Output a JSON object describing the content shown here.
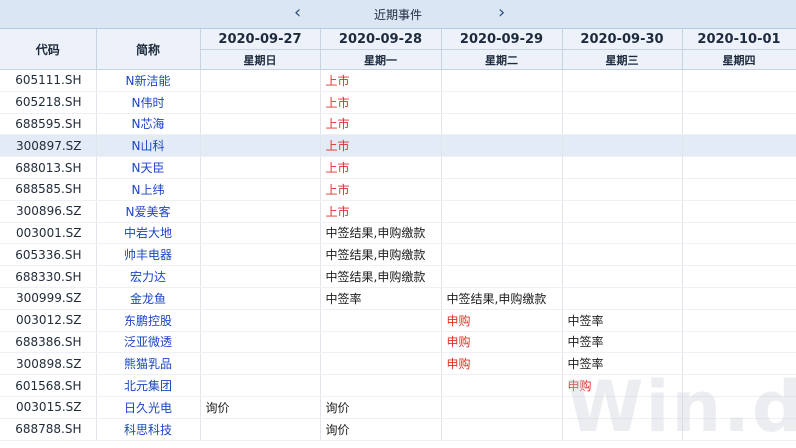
{
  "header": {
    "title": "近期事件",
    "prev_arrow": "‹",
    "next_arrow": "›"
  },
  "columns": {
    "code": "代码",
    "name": "简称"
  },
  "dates": [
    {
      "date": "2020-09-27",
      "weekday": "星期日"
    },
    {
      "date": "2020-09-28",
      "weekday": "星期一"
    },
    {
      "date": "2020-09-29",
      "weekday": "星期二"
    },
    {
      "date": "2020-09-30",
      "weekday": "星期三"
    },
    {
      "date": "2020-10-01",
      "weekday": "星期四"
    }
  ],
  "rows": [
    {
      "code": "605111.SH",
      "name": "N新洁能",
      "events": [
        "",
        "上市",
        "",
        "",
        ""
      ]
    },
    {
      "code": "605218.SH",
      "name": "N伟时",
      "events": [
        "",
        "上市",
        "",
        "",
        ""
      ]
    },
    {
      "code": "688595.SH",
      "name": "N芯海",
      "events": [
        "",
        "上市",
        "",
        "",
        ""
      ]
    },
    {
      "code": "300897.SZ",
      "name": "N山科",
      "events": [
        "",
        "上市",
        "",
        "",
        ""
      ]
    },
    {
      "code": "688013.SH",
      "name": "N天臣",
      "events": [
        "",
        "上市",
        "",
        "",
        ""
      ]
    },
    {
      "code": "688585.SH",
      "name": "N上纬",
      "events": [
        "",
        "上市",
        "",
        "",
        ""
      ]
    },
    {
      "code": "300896.SZ",
      "name": "N爱美客",
      "events": [
        "",
        "上市",
        "",
        "",
        ""
      ]
    },
    {
      "code": "003001.SZ",
      "name": "中岩大地",
      "events": [
        "",
        "中签结果,申购缴款",
        "",
        "",
        ""
      ]
    },
    {
      "code": "605336.SH",
      "name": "帅丰电器",
      "events": [
        "",
        "中签结果,申购缴款",
        "",
        "",
        ""
      ]
    },
    {
      "code": "688330.SH",
      "name": "宏力达",
      "events": [
        "",
        "中签结果,申购缴款",
        "",
        "",
        ""
      ]
    },
    {
      "code": "300999.SZ",
      "name": "金龙鱼",
      "events": [
        "",
        "中签率",
        "中签结果,申购缴款",
        "",
        ""
      ]
    },
    {
      "code": "003012.SZ",
      "name": "东鹏控股",
      "events": [
        "",
        "",
        "申购",
        "中签率",
        ""
      ]
    },
    {
      "code": "688386.SH",
      "name": "泛亚微透",
      "events": [
        "",
        "",
        "申购",
        "中签率",
        ""
      ]
    },
    {
      "code": "300898.SZ",
      "name": "熊猫乳品",
      "events": [
        "",
        "",
        "申购",
        "中签率",
        ""
      ]
    },
    {
      "code": "601568.SH",
      "name": "北元集团",
      "events": [
        "",
        "",
        "",
        "申购",
        ""
      ]
    },
    {
      "code": "003015.SZ",
      "name": "日久光电",
      "events": [
        "询价",
        "询价",
        "",
        "",
        ""
      ]
    },
    {
      "code": "688788.SH",
      "name": "科思科技",
      "events": [
        "",
        "询价",
        "",
        "",
        ""
      ]
    }
  ],
  "highlight_colors": {
    "listing": "#e0302a",
    "subscribe": "#e0302a",
    "selected_row": "#e3ebf7"
  },
  "watermark": "Win.d"
}
